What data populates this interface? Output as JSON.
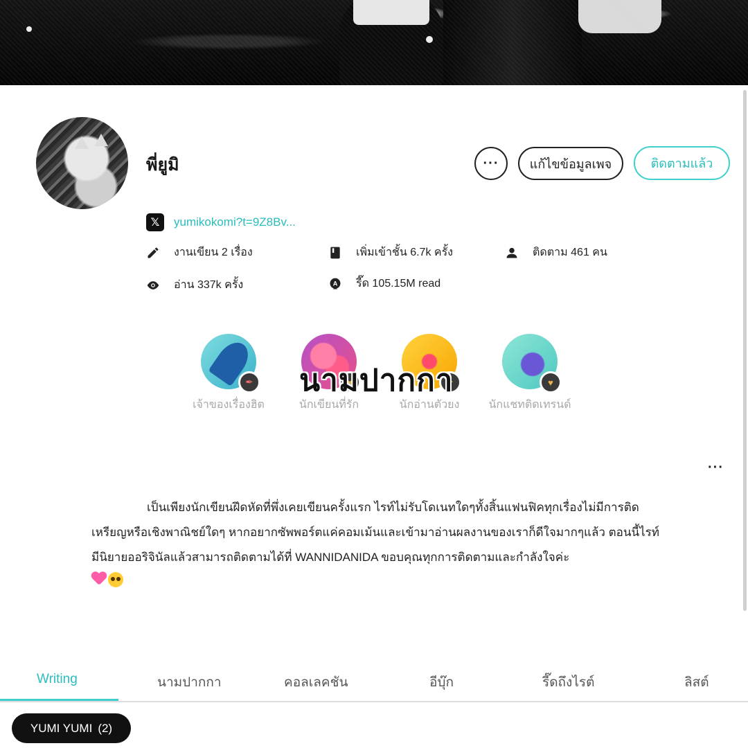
{
  "profile": {
    "name": "พี่ยูมิ",
    "more_label": "···",
    "edit_label": "แก้ไขข้อมูลเพจ",
    "follow_label": "ติดตามแล้ว",
    "x_handle": "yumikokomi?t=9Z8Bv...",
    "x_icon_glyph": "𝕏"
  },
  "stats": {
    "works": "งานเขียน 2 เรื่อง",
    "shelved": "เพิ่มเข้าชั้น 6.7k ครั้ง",
    "followers": "ติดตาม 461 คน",
    "reads": "อ่าน 337k ครั้ง",
    "coins": "รี๊ด 105.15M read"
  },
  "badges": [
    {
      "label": "เจ้าของเรื่องฮิต",
      "icon": "quill-icon"
    },
    {
      "label": "นักเขียนที่รัก",
      "icon": "hearts-icon"
    },
    {
      "label": "นักอ่านตัวยง",
      "icon": "sparkle-icon"
    },
    {
      "label": "นักแชทติดเทรนด์",
      "icon": "chat-heart-icon"
    }
  ],
  "overlay_title": "นามปากกา",
  "bio": {
    "more_label": "···",
    "text": "เป็นเพียงนักเขียนฝึดหัดที่พึ่งเคยเขียนครั้งแรก ไรท์ไม่รับโดเนทใดๆทั้งสิ้นแฟนฟิคทุกเรื่องไม่มีการติดเหรียญหรือเชิงพาณิชย์ใดๆ หากอยากซัพพอร์ตแค่คอมเม้นและเข้ามาอ่านผลงานของเราก็ดีใจมากๆแล้ว ตอนนี้ไรท์มีนิยายออริจินัลแล้วสามารถติดตามได้ที่ WANNIDANIDA ขอบคุณทุกการติดตามและกำลังใจค่ะ"
  },
  "tabs": [
    "Writing",
    "นามปากกา",
    "คอลเลคชัน",
    "อีบุ๊ก",
    "รี๊ดถึงไรต์",
    "ลิสต์"
  ],
  "chip": {
    "label": "YUMI YUMI",
    "count": "(2)"
  },
  "colors": {
    "accent": "#2bbcbc",
    "accent_border": "#3fcfcf",
    "muted": "#a7a7a7"
  }
}
